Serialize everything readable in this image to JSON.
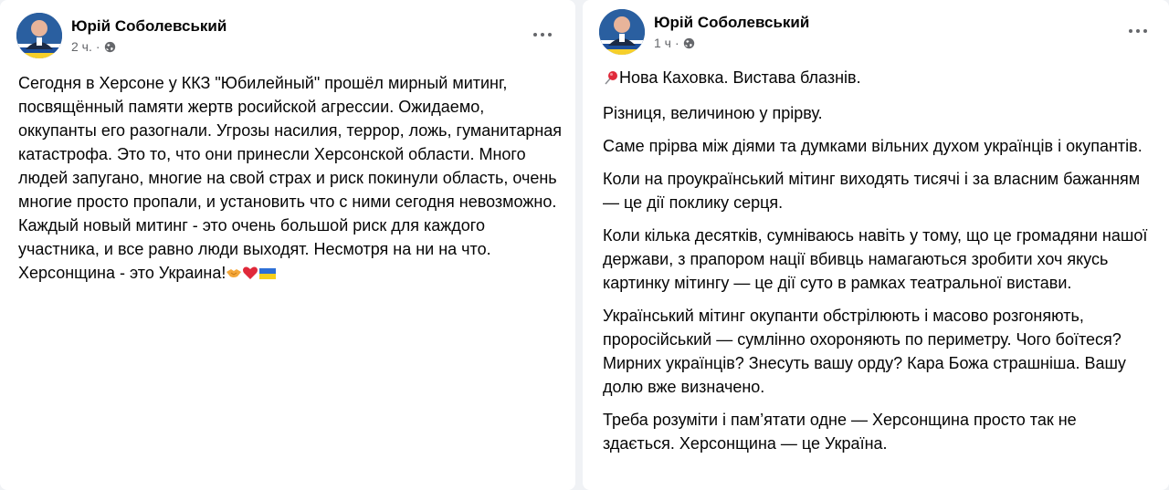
{
  "posts": [
    {
      "author": "Юрій Соболевський",
      "time": "2 ч.",
      "separator": "·",
      "privacy_icon": "public-globe-icon",
      "text": "Сегодня в Херсоне у ККЗ \"Юбилейный\" прошёл мирный митинг, посвящённый памяти жертв росийской агрессии. Ожидаемо, оккупанты его разогнали. Угрозы насилия, террор, ложь, гуманитарная катастрофа. Это то, что они принесли Херсонской области. Много людей запугано, многие на свой страх и риск покинули область, очень многие просто пропали, и установить что с ними сегодня невозможно. Каждый новый митинг - это очень большой риск для каждого участника, и все равно люди выходят. Несмотря на ни на что. Херсонщина - это Украина!",
      "emojis": [
        "handshake-emoji",
        "red-heart-emoji",
        "ukraine-flag-emoji"
      ]
    },
    {
      "author": "Юрій Соболевський",
      "time": "1 ч",
      "separator": "·",
      "privacy_icon": "public-globe-icon",
      "lead_icon": "round-pushpin-icon",
      "paragraphs": [
        "Нова Каховка. Вистава блазнів.",
        "Різниця, величиною у прірву.",
        "Саме прірва між діями та думками вільних духом українців і окупантів.",
        "Коли на проукраїнський мітинг виходять тисячі і за власним бажанням — це дії поклику серця.",
        "Коли кілька десятків, сумніваюсь навіть у тому, що це громадяни нашої держави, з прапором нації вбивць намагаються зробити хоч якусь картинку мітингу — це дії суто в рамках театральної вистави.",
        "Український мітинг окупанти обстрілюють і масово розгоняють, проросійський — сумлінно охороняють по периметру. Чого боїтеся? Мирних українців? Знесуть вашу орду? Кара Божа страшніша. Вашу долю вже визначено.",
        "Треба розуміти і пам’ятати одне — Херсонщина просто так не здається. Херсонщина — це Україна."
      ]
    }
  ]
}
